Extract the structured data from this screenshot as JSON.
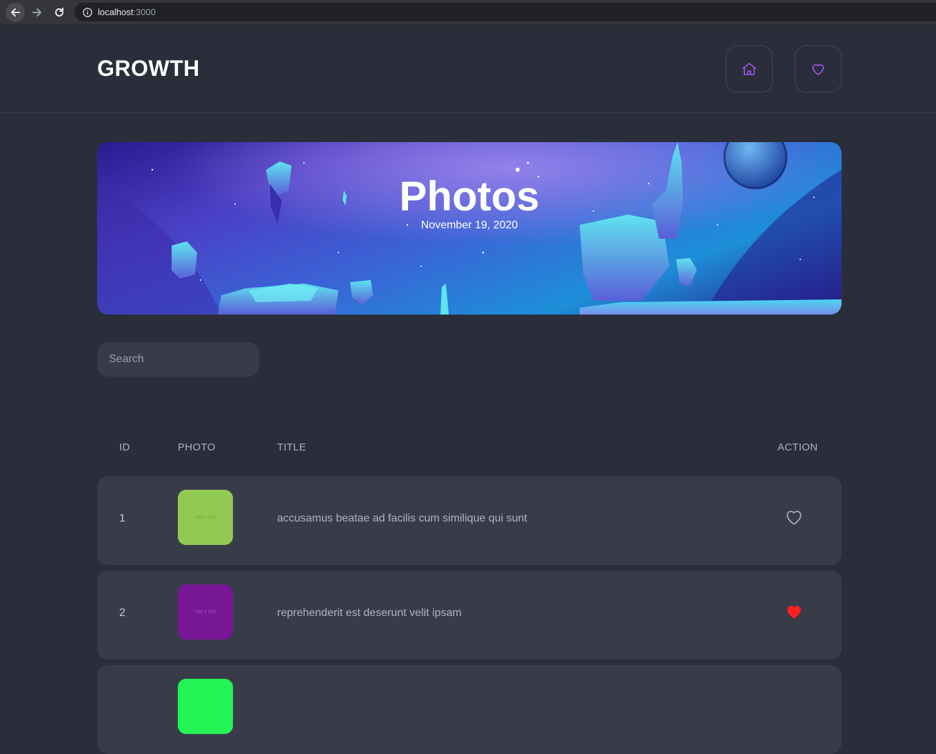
{
  "browser": {
    "url_host": "localhost",
    "url_port": ":3000"
  },
  "header": {
    "logo": "GROWTH",
    "home_icon": "home-icon",
    "favorites_icon": "heart-icon",
    "accent_color": "#a855f7"
  },
  "banner": {
    "title": "Photos",
    "date": "November 19, 2020"
  },
  "search": {
    "placeholder": "Search",
    "value": ""
  },
  "table": {
    "columns": {
      "id": "ID",
      "photo": "PHOTO",
      "title": "TITLE",
      "action": "ACTION"
    },
    "rows": [
      {
        "id": "1",
        "thumb_color": "#92c952",
        "thumb_text": "150 x 150",
        "title": "accusamus beatae ad facilis cum similique qui sunt",
        "liked": false
      },
      {
        "id": "2",
        "thumb_color": "#771796",
        "thumb_text": "150 x 150",
        "title": "reprehenderit est deserunt velit ipsam",
        "liked": true
      },
      {
        "id": "",
        "thumb_color": "#24f355",
        "thumb_text": "",
        "title": "",
        "liked": false
      }
    ]
  }
}
